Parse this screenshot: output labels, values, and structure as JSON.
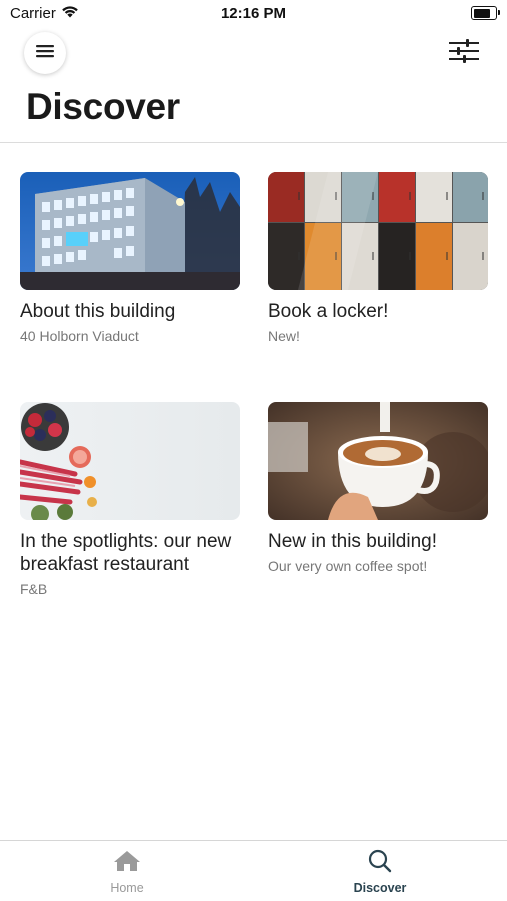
{
  "status_bar": {
    "carrier": "Carrier",
    "time": "12:16 PM",
    "battery_level": 0.9
  },
  "header": {
    "title": "Discover",
    "menu_icon": "hamburger-icon",
    "filter_icon": "sliders-icon"
  },
  "cards": [
    {
      "title": "About this building",
      "subtitle": "40 Holborn Viaduct",
      "image": "office-building-photo"
    },
    {
      "title": "Book a locker!",
      "subtitle": "New!",
      "image": "colorful-lockers-photo"
    },
    {
      "title": "In the spotlights: our new breakfast restaurant",
      "subtitle": "F&B",
      "image": "fruit-breakfast-photo"
    },
    {
      "title": "New in this building!",
      "subtitle": "Our very own coffee spot!",
      "image": "latte-art-photo"
    }
  ],
  "tabbar": {
    "items": [
      {
        "label": "Home",
        "icon": "home-icon",
        "active": false
      },
      {
        "label": "Discover",
        "icon": "search-icon",
        "active": true
      }
    ]
  },
  "colors": {
    "active_tab": "#2b4450",
    "inactive_tab": "#999999",
    "divider": "#dcdcdc"
  }
}
